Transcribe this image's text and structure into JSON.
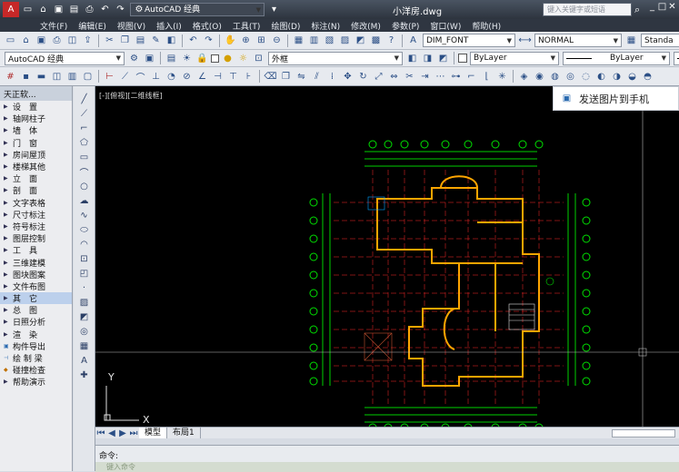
{
  "title_bar": {
    "workspace": "AutoCAD 经典",
    "doc_title": "小洋房.dwg",
    "search_placeholder": "键入关键字或短语"
  },
  "menus": [
    "文件(F)",
    "编辑(E)",
    "视图(V)",
    "插入(I)",
    "格式(O)",
    "工具(T)",
    "绘图(D)",
    "标注(N)",
    "修改(M)",
    "参数(P)",
    "窗口(W)",
    "帮助(H)"
  ],
  "toolbar1": {
    "text_style": "DIM_FONT",
    "dim_style": "NORMAL",
    "table_style": "Standa"
  },
  "toolbar2": {
    "workspace": "AutoCAD 经典",
    "layer": "外框",
    "color": "ByLayer",
    "linetype": "ByLayer",
    "lineweight": "ByLayer"
  },
  "panel": {
    "title": "天正软...",
    "items": [
      "设　置",
      "轴网柱子",
      "墙　体",
      "门　窗",
      "房间屋顶",
      "楼梯其他",
      "立　面",
      "剖　面",
      "文字表格",
      "尺寸标注",
      "符号标注",
      "图层控制",
      "工　具",
      "三维建模",
      "图块图案",
      "文件布图",
      "其　它",
      "总　图",
      "日照分析",
      "渲　染",
      "构件导出",
      "绘 制 梁",
      "碰撞检查",
      "帮助演示"
    ]
  },
  "canvas": {
    "view_label": "[-][俯视][二维线框]",
    "background_color": "#000000",
    "wall_color": "#ffa500",
    "dim_color": "#00e000",
    "axis_color": "#ff2a2a"
  },
  "popup": {
    "label": "发送图片到手机"
  },
  "tabs": {
    "model": "模型",
    "layout": "布局1"
  },
  "command": {
    "label": "命令:",
    "placeholder": "键入命令"
  }
}
